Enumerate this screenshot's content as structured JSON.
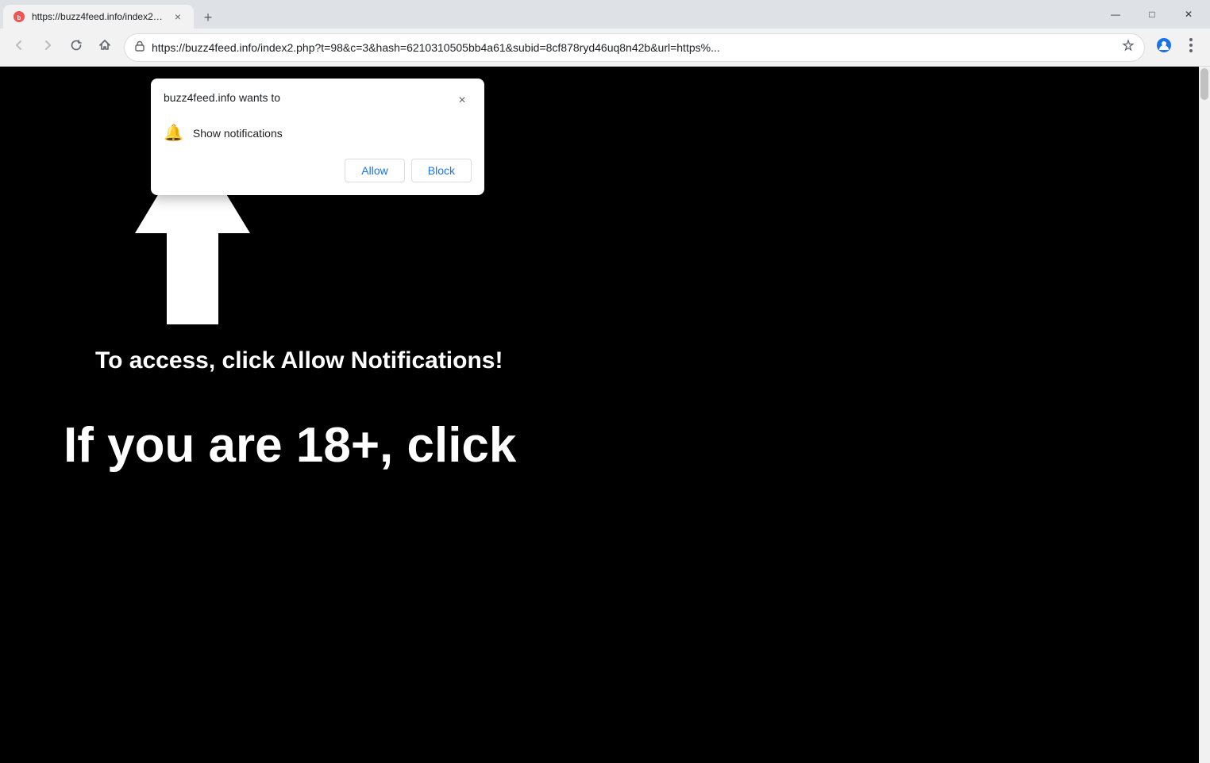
{
  "browser": {
    "tab": {
      "favicon_label": "buzz4feed",
      "title": "https://buzz4feed.info/index2.ph",
      "close_label": "×"
    },
    "new_tab_label": "+",
    "window_controls": {
      "minimize": "—",
      "maximize": "□",
      "close": "✕"
    },
    "toolbar": {
      "back_label": "←",
      "forward_label": "→",
      "reload_label": "↻",
      "home_label": "⌂",
      "address": "https://buzz4feed.info/index2.php?t=98&c=3&hash=6210310505bb4a61&subid=8cf878ryd46uq8n42b&url=https%...",
      "star_label": "☆",
      "profile_label": "👤",
      "menu_label": "⋮"
    }
  },
  "notification_popup": {
    "title": "buzz4feed.info wants to",
    "close_label": "×",
    "permission": {
      "icon_label": "🔔",
      "text": "Show notifications"
    },
    "allow_label": "Allow",
    "block_label": "Block"
  },
  "page": {
    "arrow_label": "↑",
    "instruction_text": "To access, click Allow\nNotifications!",
    "bottom_text": "If you are 18+, click"
  }
}
